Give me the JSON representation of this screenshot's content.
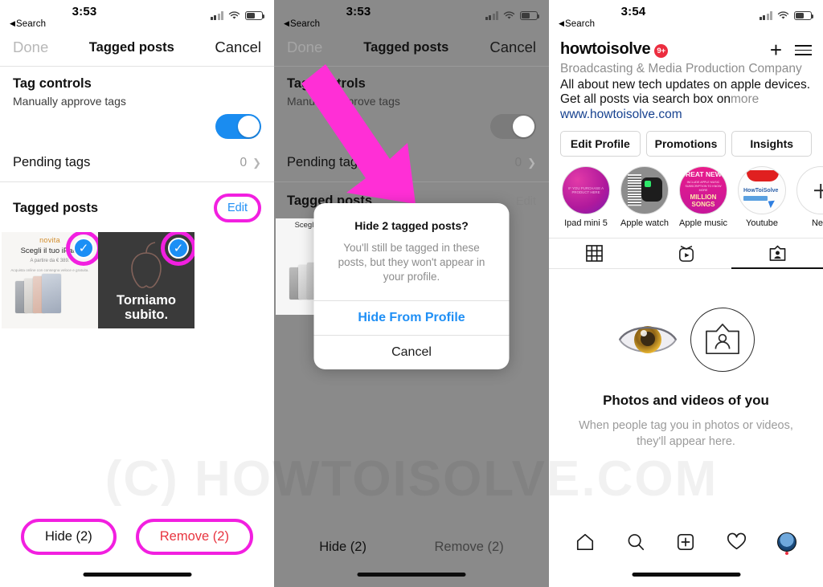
{
  "panel1": {
    "status": {
      "time": "3:53",
      "back_label": "Search"
    },
    "nav": {
      "done": "Done",
      "title": "Tagged posts",
      "cancel": "Cancel"
    },
    "tag_controls": {
      "title": "Tag controls",
      "subtitle": "Manually approve tags",
      "toggle_on": true,
      "toggle_color": "#1a8cf0"
    },
    "pending": {
      "label": "Pending tags",
      "count": "0"
    },
    "tagged_posts": {
      "title": "Tagged posts",
      "edit": "Edit"
    },
    "thumbnails": [
      {
        "type": "ad",
        "header": "novita",
        "title": "Scegli il tuo iPad.",
        "subtitle": "A partire da € 389.",
        "note": "Acquista online con consegna veloce e gratuita.",
        "selected": true
      },
      {
        "type": "dark",
        "text_line1": "Torniamo",
        "text_line2": "subito.",
        "selected": true
      }
    ],
    "actions": {
      "hide": "Hide (2)",
      "remove": "Remove (2)"
    },
    "highlight_color": "#f21fe0"
  },
  "panel2": {
    "status": {
      "time": "3:53",
      "back_label": "Search"
    },
    "nav": {
      "done": "Done",
      "title": "Tagged posts",
      "cancel": "Cancel"
    },
    "tag_controls": {
      "title": "Tag controls",
      "subtitle": "Manually approve tags"
    },
    "pending": {
      "label": "Pending tags",
      "count": "0"
    },
    "tagged_posts": {
      "title": "Tagged posts",
      "edit": "Edit"
    },
    "actions": {
      "hide": "Hide (2)",
      "remove": "Remove (2)"
    },
    "dialog": {
      "title": "Hide 2 tagged posts?",
      "message": "You'll still be tagged in these posts, but they won't appear in your profile.",
      "confirm": "Hide From Profile",
      "cancel": "Cancel"
    },
    "arrow_color": "#ff2fd6"
  },
  "panel3": {
    "status": {
      "time": "3:54",
      "back_label": "Search"
    },
    "profile": {
      "username": "howtoisolve",
      "badge": "9+",
      "category": "Broadcasting & Media Production Company",
      "bio": "All about new tech updates on apple devices. Get all posts via search box on",
      "more": "more",
      "website": "www.howtoisolve.com"
    },
    "buttons": [
      "Edit Profile",
      "Promotions",
      "Insights"
    ],
    "highlights": [
      {
        "label": "Ipad mini 5",
        "inner_text": "IF YOU PURCHASE A PRODUCT HERE"
      },
      {
        "label": "Apple watch",
        "inner_text": ""
      },
      {
        "label": "Apple music",
        "inner_text": "GREAT NEWS",
        "inner_sub": "INCLUDE APPLE MUSIC SUBSCRIPTION TO KNOW MORE",
        "inner_bottom": "MILLION SONGS"
      },
      {
        "label": "Youtube",
        "inner_text": "HowToiSolve"
      },
      {
        "label": "New",
        "inner_text": "+"
      }
    ],
    "tabs": [
      {
        "name": "grid-tab",
        "active": false
      },
      {
        "name": "igtv-tab",
        "active": false
      },
      {
        "name": "tagged-tab",
        "active": true
      }
    ],
    "empty_state": {
      "title": "Photos and videos of you",
      "subtitle": "When people tag you in photos or videos, they'll appear here."
    },
    "tabbar": [
      "home-icon",
      "search-icon",
      "add-post-icon",
      "activity-icon",
      "profile-avatar"
    ]
  },
  "watermark": {
    "text": "(C) HOWTOISOLVE.COM"
  }
}
